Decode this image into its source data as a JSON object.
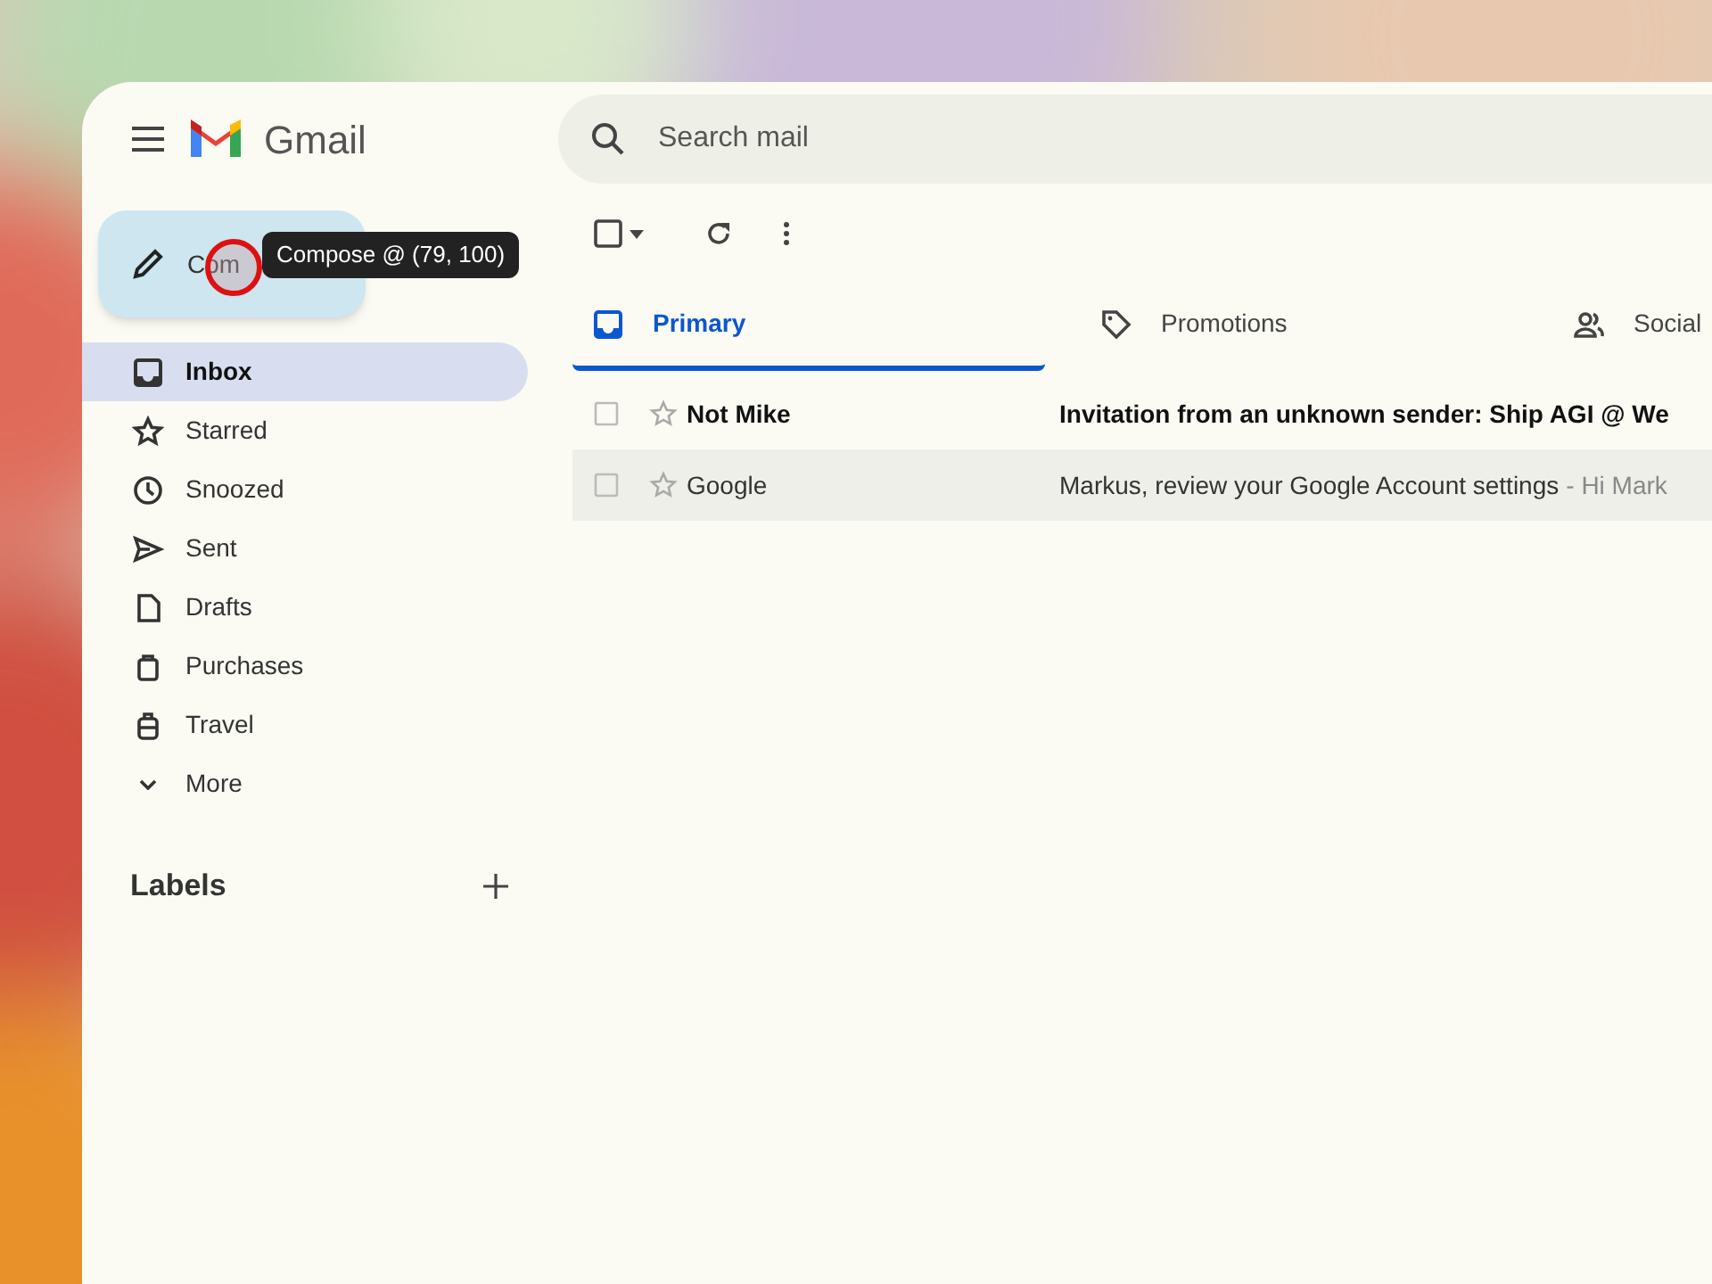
{
  "app": {
    "name": "Gmail"
  },
  "search": {
    "placeholder": "Search mail"
  },
  "compose": {
    "label": "Com"
  },
  "tooltip": {
    "text": "Compose @ (79, 100)"
  },
  "nav": [
    {
      "label": "Inbox",
      "kind": "inbox",
      "selected": true
    },
    {
      "label": "Starred",
      "kind": "star",
      "selected": false
    },
    {
      "label": "Snoozed",
      "kind": "clock",
      "selected": false
    },
    {
      "label": "Sent",
      "kind": "send",
      "selected": false
    },
    {
      "label": "Drafts",
      "kind": "file",
      "selected": false
    },
    {
      "label": "Purchases",
      "kind": "bag",
      "selected": false
    },
    {
      "label": "Travel",
      "kind": "luggage",
      "selected": false
    },
    {
      "label": "More",
      "kind": "chevron",
      "selected": false
    }
  ],
  "labels": {
    "title": "Labels"
  },
  "tabs": [
    {
      "label": "Primary",
      "kind": "inbox",
      "selected": true
    },
    {
      "label": "Promotions",
      "kind": "tag",
      "selected": false
    },
    {
      "label": "Social",
      "kind": "people",
      "selected": false
    }
  ],
  "emails": [
    {
      "sender": "Not Mike",
      "subject": "Invitation from an unknown sender: Ship AGI @ We",
      "unread": true
    },
    {
      "sender": "Google",
      "subject": "Markus, review your Google Account settings",
      "snippet": "- Hi Mark",
      "unread": false
    }
  ]
}
